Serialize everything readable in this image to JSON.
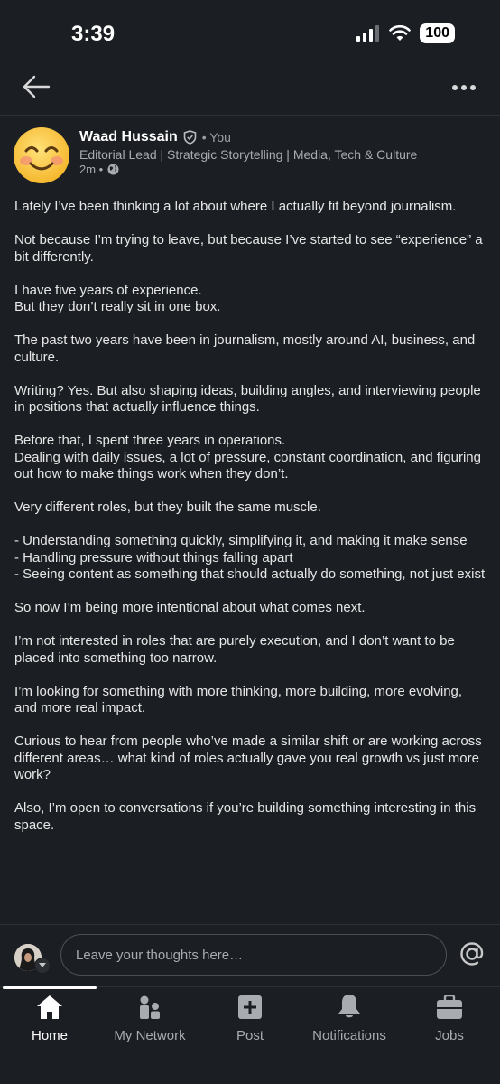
{
  "status_bar": {
    "time": "3:39",
    "battery": "100"
  },
  "post": {
    "author_name": "Waad Hussain",
    "you_label": "• You",
    "headline": "Editorial Lead | Strategic Storytelling | Media, Tech & Culture",
    "time": "2m •",
    "paragraphs": [
      "Lately I’ve been thinking a lot about where I actually fit beyond journalism.",
      "Not because I’m trying to leave, but because I’ve started to see “experience” a bit differently.",
      "I have five years of experience.\nBut they don’t really sit in one box.",
      "The past two years have been in journalism, mostly around AI, business, and culture.",
      "Writing? Yes. But also shaping ideas, building angles, and interviewing people in positions that actually influence things.",
      "Before that, I spent three years in operations.\nDealing with daily issues, a lot of pressure, constant coordination, and figuring out how to make things work when they don’t.",
      "Very different roles, but they built the same muscle.",
      "- Understanding something quickly, simplifying it, and making it make sense\n- Handling pressure without things falling apart\n- Seeing content as something that should actually do something, not just exist",
      "So now I’m being more intentional about what comes next.",
      "I’m not interested in roles that are purely execution, and I don’t want to be placed into something too narrow.",
      "I’m looking for something with more thinking, more building, more evolving, and more real impact.",
      "Curious to hear from people who’ve made a similar shift or are working across different areas… what kind of roles actually gave you real growth vs just more work?",
      "Also, I’m open to conversations if you’re building something interesting in this space."
    ]
  },
  "comment": {
    "placeholder": "Leave your thoughts here…"
  },
  "nav": {
    "items": [
      {
        "label": "Home",
        "icon": "home-icon",
        "active": true
      },
      {
        "label": "My Network",
        "icon": "network-icon"
      },
      {
        "label": "Post",
        "icon": "post-icon"
      },
      {
        "label": "Notifications",
        "icon": "bell-icon"
      },
      {
        "label": "Jobs",
        "icon": "briefcase-icon"
      }
    ]
  },
  "colors": {
    "background": "#1b1f23",
    "text": "#e6e6e6",
    "muted": "#a8acb0"
  }
}
